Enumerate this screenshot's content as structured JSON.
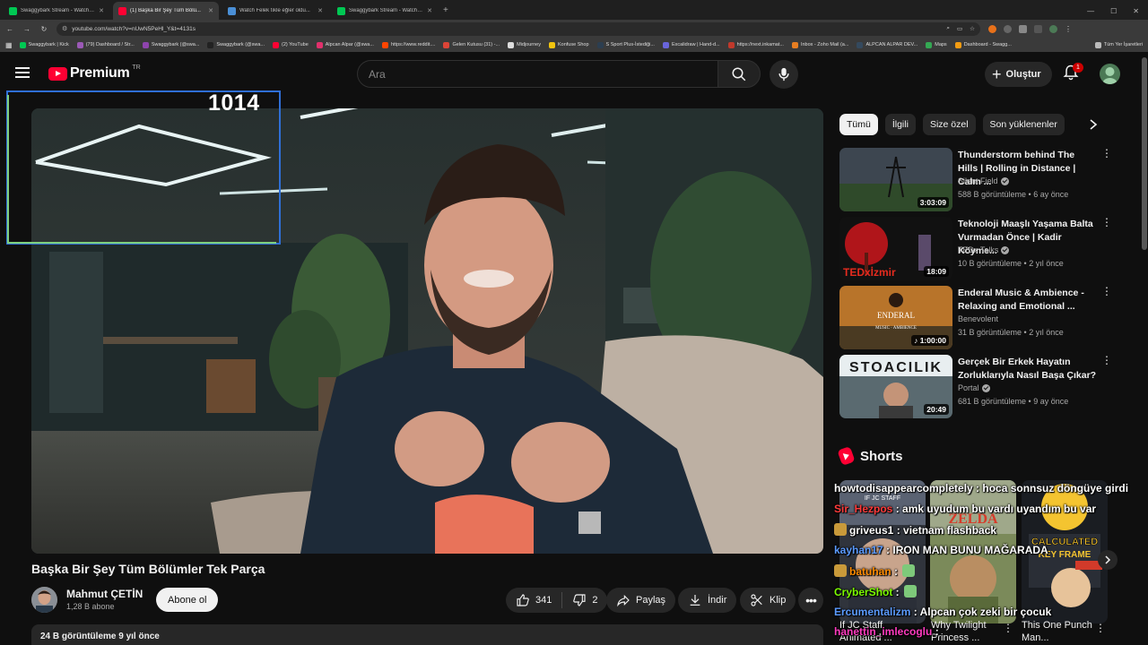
{
  "browser": {
    "tabs": [
      {
        "title": "Swaggybark Stream - Watch L...",
        "fav": "#00c853",
        "active": false
      },
      {
        "title": "(1) Başka Bir Şey Tüm Bölü...",
        "fav": "#ff0033",
        "active": true
      },
      {
        "title": "Watch Felek tıkle eğler oldu...",
        "fav": "#4a8fd6",
        "active": false
      },
      {
        "title": "Swaggybark Stream - Watch L...",
        "fav": "#00c853",
        "active": false
      }
    ],
    "url": "youtube.com/watch?v=nUwN5PeHl_Y&t=4131s",
    "bookmarks": [
      {
        "label": "Swaggybark | Kick",
        "color": "#00c853"
      },
      {
        "label": "(79) Dashboard / Str...",
        "color": "#9b59b6"
      },
      {
        "label": "Swaggybark (@swa...",
        "color": "#8e44ad"
      },
      {
        "label": "Swaggybark (@swa...",
        "color": "#222222"
      },
      {
        "label": "(2) YouTube",
        "color": "#ff0033"
      },
      {
        "label": "Alpcan Alpar (@swa...",
        "color": "#e1306c"
      },
      {
        "label": "https://www.reddit....",
        "color": "#ff4500"
      },
      {
        "label": "Gelen Kutusu (31) -...",
        "color": "#db4437"
      },
      {
        "label": "Midjourney",
        "color": "#dddddd"
      },
      {
        "label": "Konfuse Shop",
        "color": "#f1c40f"
      },
      {
        "label": "S Sport Plus-İstediği...",
        "color": "#2c3e50"
      },
      {
        "label": "Excalidraw | Hand-d...",
        "color": "#6965db"
      },
      {
        "label": "https://next.inkamat...",
        "color": "#c0392b"
      },
      {
        "label": "Inbox - Zoho Mail (a...",
        "color": "#e67e22"
      },
      {
        "label": "ALPCAN ALPAR DEV...",
        "color": "#34495e"
      },
      {
        "label": "Maps",
        "color": "#34a853"
      },
      {
        "label": "Dashboard - Swagg...",
        "color": "#f39c12"
      }
    ],
    "bookmarks_all": "Tüm Yer İşaretleri"
  },
  "masthead": {
    "logo": "Premium",
    "region": "TR",
    "search_placeholder": "Ara",
    "create_label": "Oluştur",
    "notification_count": "1"
  },
  "overlay": {
    "counter": "1014"
  },
  "video": {
    "title": "Başka Bir Şey Tüm Bölümler Tek Parça",
    "channel": "Mahmut ÇETİN",
    "subscribers": "1,28 B abone",
    "subscribe_label": "Abone ol",
    "likes": "341",
    "dislikes": "2",
    "share_label": "Paylaş",
    "download_label": "İndir",
    "clip_label": "Klip",
    "description_meta": "24 B görüntüleme  9 yıl önce"
  },
  "chips": [
    "Tümü",
    "İlgili",
    "Size özel",
    "Son yüklenenler"
  ],
  "recommendations": [
    {
      "title": "Thunderstorm behind The Hills | Rolling in Distance | Calm ...",
      "channel": "Silent Field",
      "verified": true,
      "meta": "588 B görüntüleme  •  6 ay önce",
      "duration": "3:03:09"
    },
    {
      "title": "Teknoloji Maaşlı Yaşama Balta Vurmadan Önce | Kadir Köyme...",
      "channel": "TEDx Talks",
      "verified": true,
      "meta": "10 B görüntüleme  •  2 yıl önce",
      "duration": "18:09",
      "thumb_text": "TEDxİzmir"
    },
    {
      "title": "Enderal Music & Ambience - Relaxing and Emotional ...",
      "channel": "Benevolent",
      "verified": false,
      "meta": "31 B görüntüleme  •  2 yıl önce",
      "duration": "♪ 1:00:00",
      "thumb_text": "ENDERAL",
      "thumb_sub": "MUSIC · AMBIENCE"
    },
    {
      "title": "Gerçek Bir Erkek Hayatın Zorluklarıyla Nasıl Başa Çıkar?",
      "channel": "Portal",
      "verified": true,
      "meta": "681 B görüntüleme  •  9 ay önce",
      "duration": "20:49",
      "thumb_text": "STOACILIK"
    }
  ],
  "shorts": {
    "heading": "Shorts",
    "items": [
      {
        "title": "If JC Staff Animated ..."
      },
      {
        "title": "Why Twilight Princess ..."
      },
      {
        "title": "This One Punch Man..."
      }
    ],
    "thumb_texts": {
      "zelda": "ZELDA",
      "calculated": "CALCULATED",
      "frame": "KEY FRAME",
      "jc": "IF JC STAFF"
    }
  },
  "chat": [
    {
      "user": "howtodisappearcompletely",
      "color": "#ffffff",
      "text": " : hoca sonnsuz döngüye girdi"
    },
    {
      "user": "Sir_Hezpos",
      "color": "#ff3b3b",
      "text": " : amk uyudum bu vardı uyandım bu var"
    },
    {
      "user": "griveus1",
      "color": "#ffffff",
      "text": " : vietnam flashback",
      "emote_before": true
    },
    {
      "user": "kayhan17",
      "color": "#5b9bff",
      "text": " : IRON MAN BUNU MAĞARADA"
    },
    {
      "user": "batuhan",
      "color": "#ff8c00",
      "text": " :",
      "emote_before": true,
      "emote_after": true
    },
    {
      "user": "CryberShot",
      "color": "#7CFC00",
      "text": " :",
      "emote_after": true
    },
    {
      "user": "Ercumentalizm",
      "color": "#5b9bff",
      "text": " : Alpcan çok zeki bir çocuk"
    },
    {
      "user": "hanettin_imlecoglu",
      "color": "#ff3bbf",
      "text": " :"
    }
  ]
}
